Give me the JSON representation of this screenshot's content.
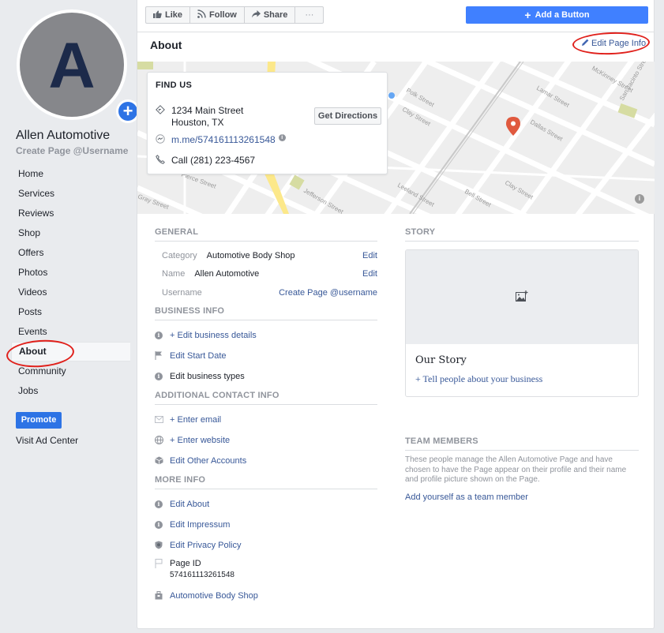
{
  "page": {
    "avatar_letter": "A",
    "name": "Allen Automotive",
    "username_prompt": "Create Page @Username"
  },
  "sidebar": {
    "items": [
      {
        "label": "Home"
      },
      {
        "label": "Services"
      },
      {
        "label": "Reviews"
      },
      {
        "label": "Shop"
      },
      {
        "label": "Offers"
      },
      {
        "label": "Photos"
      },
      {
        "label": "Videos"
      },
      {
        "label": "Posts"
      },
      {
        "label": "Events"
      },
      {
        "label": "About",
        "active": true
      },
      {
        "label": "Community"
      },
      {
        "label": "Jobs"
      }
    ],
    "promote_label": "Promote",
    "visit_ad_center": "Visit Ad Center"
  },
  "toolbar": {
    "like": "Like",
    "follow": "Follow",
    "share": "Share",
    "more": "···",
    "add_button": "Add a Button"
  },
  "header": {
    "title": "About",
    "edit_page_info": "Edit Page Info"
  },
  "find_us": {
    "title": "FIND US",
    "address_line1": "1234 Main Street",
    "address_line2": "Houston, TX",
    "get_directions": "Get Directions",
    "messenger": "m.me/574161113261548",
    "phone": "Call (281) 223-4567"
  },
  "map": {
    "streets": [
      "McKinney Street",
      "Polk Street",
      "Lamar Street",
      "Clay Street",
      "Dallas Street",
      "San Jacinto Street",
      "Leeland Street",
      "Bell Street",
      "Jefferson Street",
      "Pierce Street",
      "Gray Street"
    ],
    "pin_color": "#e0593e"
  },
  "general": {
    "heading": "GENERAL",
    "rows": [
      {
        "key": "Category",
        "value": "Automotive Body Shop",
        "action": "Edit"
      },
      {
        "key": "Name",
        "value": "Allen Automotive",
        "action": "Edit"
      },
      {
        "key": "Username",
        "value": "",
        "action": "Create Page @username"
      }
    ]
  },
  "business_info": {
    "heading": "BUSINESS INFO",
    "items": [
      {
        "icon": "info-icon",
        "label": "+ Edit business details",
        "link": true
      },
      {
        "icon": "flag-icon",
        "label": "Edit Start Date",
        "link": true
      },
      {
        "icon": "info-icon",
        "label": "Edit business types",
        "link": false
      }
    ]
  },
  "contact_info": {
    "heading": "ADDITIONAL CONTACT INFO",
    "items": [
      {
        "icon": "envelope-icon",
        "label": "+ Enter email"
      },
      {
        "icon": "globe-icon",
        "label": "+ Enter website"
      },
      {
        "icon": "cube-icon",
        "label": "Edit Other Accounts"
      }
    ]
  },
  "more_info": {
    "heading": "MORE INFO",
    "items": [
      {
        "icon": "info-icon",
        "label": "Edit About"
      },
      {
        "icon": "info-icon",
        "label": "Edit Impressum"
      },
      {
        "icon": "shield-icon",
        "label": "Edit Privacy Policy"
      }
    ],
    "page_id_label": "Page ID",
    "page_id_value": "574161113261548",
    "category_link": "Automotive Body Shop"
  },
  "story": {
    "heading": "STORY",
    "title": "Our Story",
    "subtitle": "+ Tell people about your business"
  },
  "team": {
    "heading": "TEAM MEMBERS",
    "description": "These people manage the Allen Automotive Page and have chosen to have the Page appear on their profile and their name and profile picture shown on the Page.",
    "add_link": "Add yourself as a team member"
  },
  "colors": {
    "primary_blue": "#4080ff",
    "link_blue": "#385898",
    "promote_blue": "#2d73e5",
    "annotation_red": "#e0201b"
  }
}
